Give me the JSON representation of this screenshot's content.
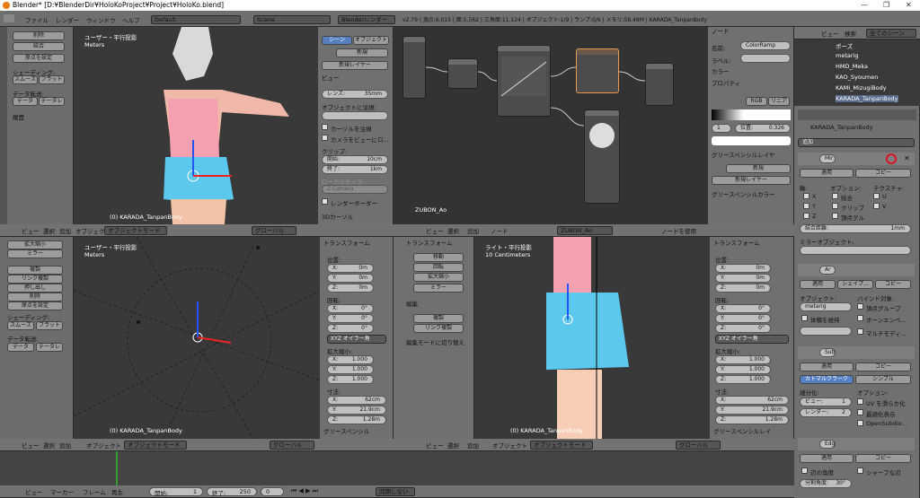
{
  "titlebar": {
    "title": "Blender* [D:¥BlenderDir¥HoloKoProject¥Project¥HoloKo.blend]",
    "min": "—",
    "max": "❐",
    "close": "✕"
  },
  "topmenu": {
    "items": [
      "ファイル",
      "レンダー",
      "ウィンドウ",
      "ヘルプ"
    ],
    "layout": "Default",
    "scene": "Scene",
    "engine": "Blenderレンダー",
    "stats": "v2.79 | 頂点:6,015 | 面:5,562 | 三角面:11,124 | オブジェクト:1/9 | ランプ:0/6 | メモリ:58.49M | KARADA_TanpanBody"
  },
  "toolshelf_top": {
    "items": [
      "削除",
      "結合",
      "原点を設定"
    ],
    "shading_label": "シェーディング:",
    "smooth": "スムーズ",
    "flat": "フラット",
    "data_transfer": "データ転送:",
    "data": "データ",
    "data2": "データレ",
    "history": "履歴"
  },
  "vp_top_left": {
    "view_label": "ユーザー・平行投影",
    "units": "Meters",
    "object_label": "(0) KARADA_TanpanBody"
  },
  "props_mid": {
    "tab_scene": "シーン",
    "tab_object": "オブジェクト",
    "new_btn": "新規",
    "new_layer": "新規レイヤー",
    "view_hdr": "ビュー",
    "lens_label": "レンズ:",
    "lens_val": "35mm",
    "lock_label": "オブジェクトに注視:",
    "cursor_lock": "カーソルを注視",
    "cam_lock": "カメラをビューにロ...",
    "clip_label": "クリップ:",
    "clip_start": "開始:",
    "clip_start_val": "10cm",
    "clip_end": "終了:",
    "clip_end_val": "1km",
    "local_cam": "ローカルカメラ:",
    "camera_val": "Z Camera",
    "render_border": "レンダーボーダー",
    "cursor3d": "3Dカーソル"
  },
  "node_editor": {
    "material_label": "ZUBON_Ao",
    "node_name": "ZUBON_Ao",
    "use_nodes": "ノードを使用",
    "menu": [
      "ビュー",
      "選択",
      "追加",
      "ノード"
    ]
  },
  "node_side": {
    "node_hdr": "ノード",
    "name_label": "名前:",
    "name_val": "ColorRamp",
    "label_label": "ラベル:",
    "color_hdr": "カラー",
    "props_hdr": "プロパティ",
    "rgb": "RGB",
    "linear": "リニア",
    "index": "1",
    "pos_label": "位置:",
    "pos_val": "0.326",
    "grease_layer": "グリースペンシルレイヤ",
    "new_btn": "新規",
    "new_layer": "新規レイヤー",
    "grease_color": "グリースペンシルカラー"
  },
  "outliner": {
    "view": "ビュー",
    "search": "検索",
    "scenes": "全てのシーン",
    "items": [
      "ポーズ",
      "metarig",
      "HMD_Meka",
      "KAO_Syoumen",
      "KAMI_MizugiBody",
      "KARADA_TanpanBody"
    ]
  },
  "modifiers": {
    "object_name": "KARADA_TanpanBody",
    "add": "追加",
    "mirror": {
      "name": "Mir",
      "apply": "適用",
      "copy": "コピー",
      "axis": "軸:",
      "options": "オプション:",
      "texture": "テクスチャ:",
      "x": "X",
      "y": "Y",
      "z": "Z",
      "merge": "結合",
      "clip": "クリップ",
      "vgroup": "頂点グル",
      "u": "U",
      "v": "V",
      "merge_dist": "結合距離:",
      "merge_val": "1mm",
      "mirror_obj": "ミラーオブジェクト:"
    },
    "armature": {
      "name": "Ar",
      "apply": "適用",
      "shape": "シェイプ...",
      "copy": "コピー",
      "object": "オブジェクト:",
      "bind": "バインド対象:",
      "obj_val": "metarig",
      "vgroups": "頂点グループ",
      "preserve": "体積を維持",
      "bone_env": "ボーンエンベ...",
      "multi": "マルチモディ..."
    },
    "subsurf": {
      "name": "Sub",
      "apply": "適用",
      "copy": "コピー",
      "catmull": "カトマルクラーク",
      "simple": "シンプル",
      "subdiv": "細分化:",
      "options": "オプション:",
      "view": "ビュー:",
      "view_val": "1",
      "render": "レンダー:",
      "render_val": "2",
      "uv_smooth": "UV を滑らか化",
      "optimal": "最適化表示",
      "opensubdiv": "OpenSubdiv..."
    },
    "edge": {
      "name": "Edg",
      "apply": "適用",
      "copy": "コピー",
      "edge_angle": "辺の角度",
      "sharp": "シャープな辺",
      "angle_label": "分割角度:",
      "angle_val": "30°"
    }
  },
  "vp_bottom_left": {
    "view_label": "ユーザー・平行投影",
    "units": "Meters",
    "object_label": "(0) KARADA_TanpanBody"
  },
  "toolshelf_bottom": {
    "items": [
      "拡大縮小",
      "ミラー",
      "複製",
      "リンク複製",
      "押し出し",
      "削除",
      "原点を設定"
    ],
    "shade": "シェーディング:",
    "smooth": "スムーズ",
    "flat": "フラット",
    "data_transfer": "データ転送:",
    "data": "データ",
    "data2": "データレ",
    "edit_toggle": "編集モードに切り替え"
  },
  "transform_left": {
    "hdr": "トランスフォーム",
    "loc": "位置:",
    "x": "X:",
    "y": "Y:",
    "z": "Z:",
    "loc_vals": [
      "0m",
      "0m",
      "0m"
    ],
    "rot": "回転:",
    "rot_vals": [
      "0°",
      "0°",
      "0°"
    ],
    "euler": "XYZ オイラー角",
    "scale": "拡大縮小:",
    "scale_vals": [
      "1.000",
      "1.000",
      "1.000"
    ],
    "dim": "寸法:",
    "dim_vals": [
      "62cm",
      "21.9cm",
      "1.28m"
    ],
    "grease": "グリースペンシル"
  },
  "tool_mid": {
    "hdr": "トランスフォーム",
    "items": [
      "移動",
      "回転",
      "拡大縮小",
      "ミラー"
    ],
    "edit_hdr": "編集",
    "edit_items": [
      "複製",
      "リンク複製"
    ],
    "edit_toggle": "編集モードに切り替え"
  },
  "vp_bottom_right": {
    "view_label": "ライト・平行投影",
    "units": "10 Centimeters",
    "object_label": "(0) KARADA_TanpanBody"
  },
  "transform_right": {
    "hdr": "トランスフォーム",
    "loc": "位置:",
    "x": "X:",
    "y": "Y:",
    "z": "Z:",
    "loc_vals": [
      "0m",
      "0m",
      "0m"
    ],
    "rot": "回転:",
    "rot_vals": [
      "0°",
      "0°",
      "0°"
    ],
    "euler": "XYZ オイラー角",
    "scale": "拡大縮小:",
    "scale_vals": [
      "1.000",
      "1.000",
      "1.000"
    ],
    "dim": "寸法:",
    "dim_vals": [
      "62cm",
      "21.9cm",
      "1.28m"
    ],
    "grease": "グリースペンシルレイ"
  },
  "vp_headers": {
    "menu": [
      "ビュー",
      "選択",
      "追加",
      "オブジェクト"
    ],
    "mode": "オブジェクトモード",
    "global": "グローバル"
  },
  "timeline": {
    "menu": [
      "ビュー",
      "マーカー",
      "フレーム",
      "再生"
    ],
    "start_label": "開始:",
    "start_val": "1",
    "end_label": "終了:",
    "end_val": "250",
    "frame_val": "0",
    "sync": "同期しない"
  }
}
